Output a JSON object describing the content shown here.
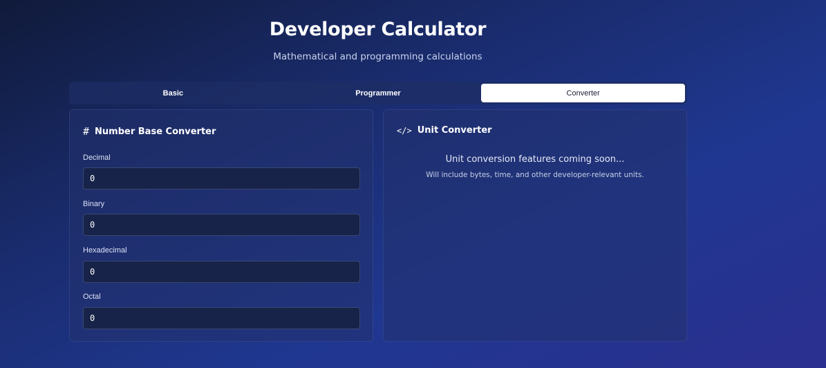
{
  "header": {
    "title": "Developer Calculator",
    "subtitle": "Mathematical and programming calculations"
  },
  "tabs": [
    {
      "label": "Basic",
      "active": false
    },
    {
      "label": "Programmer",
      "active": false
    },
    {
      "label": "Converter",
      "active": true
    }
  ],
  "number_base_converter": {
    "icon": "hash-icon",
    "title": "Number Base Converter",
    "fields": [
      {
        "label": "Decimal",
        "value": "0"
      },
      {
        "label": "Binary",
        "value": "0"
      },
      {
        "label": "Hexadecimal",
        "value": "0"
      },
      {
        "label": "Octal",
        "value": "0"
      }
    ]
  },
  "unit_converter": {
    "icon": "code-icon",
    "title": "Unit Converter",
    "message": "Unit conversion features coming soon...",
    "submessage": "Will include bytes, time, and other developer-relevant units."
  }
}
